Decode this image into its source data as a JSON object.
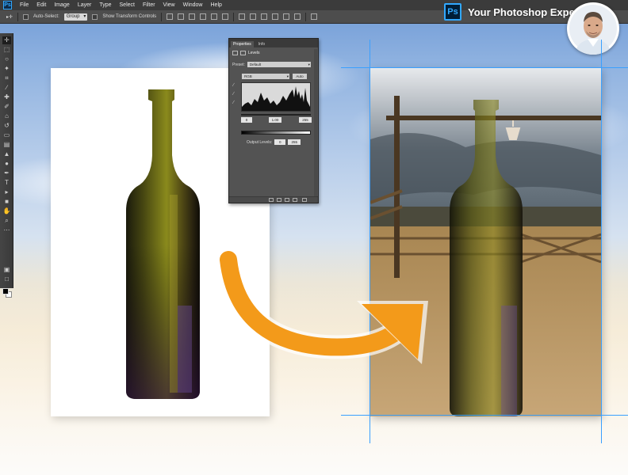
{
  "menubar": {
    "app_icon": "Ps",
    "items": [
      "File",
      "Edit",
      "Image",
      "Layer",
      "Type",
      "Select",
      "Filter",
      "View",
      "Window",
      "Help"
    ]
  },
  "options_bar": {
    "auto_select_label": "Auto-Select:",
    "auto_select_value": "Group",
    "show_transform_label": "Show Transform Controls"
  },
  "brand": {
    "logo_text": "Ps",
    "title": "Your Photoshop Expert"
  },
  "properties_panel": {
    "tabs": [
      "Properties",
      "Info"
    ],
    "adjustment_title": "Levels",
    "preset_label": "Preset:",
    "preset_value": "Default",
    "channel_value": "RGB",
    "auto_button": "Auto",
    "input_black": "0",
    "input_gamma": "1.00",
    "input_white": "255",
    "output_label": "Output Levels:",
    "output_black": "0",
    "output_white": "255"
  },
  "colors": {
    "accent": "#31a8ff",
    "arrow": "#f39a1a",
    "guide": "#3aa0ff"
  }
}
